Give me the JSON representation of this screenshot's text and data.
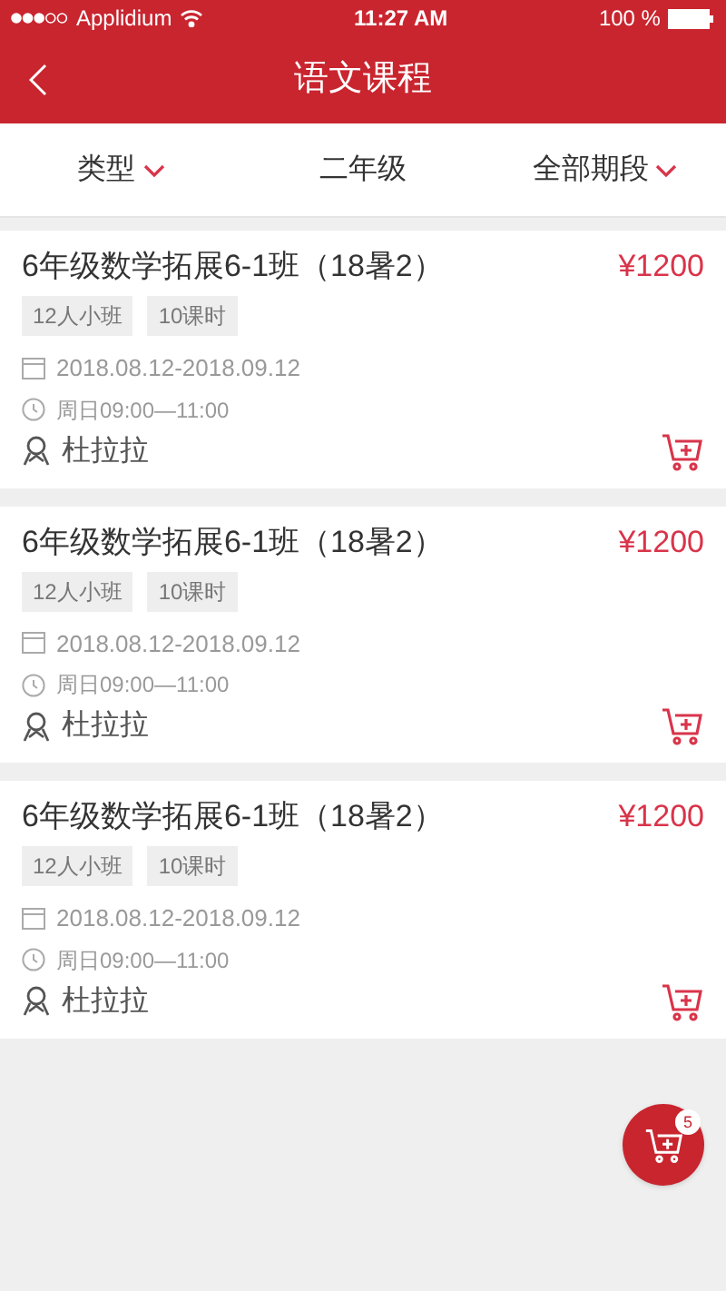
{
  "status_bar": {
    "carrier": "Applidium",
    "time": "11:27 AM",
    "battery": "100 %"
  },
  "nav": {
    "title": "语文课程"
  },
  "filters": [
    {
      "label": "类型",
      "dropdown": true
    },
    {
      "label": "二年级",
      "dropdown": false
    },
    {
      "label": "全部期段",
      "dropdown": true
    }
  ],
  "courses": [
    {
      "title": "6年级数学拓展6-1班（18暑2）",
      "price": "¥1200",
      "tags": [
        "12人小班",
        "10课时"
      ],
      "dates": "2018.08.12-2018.09.12",
      "time": "周日09:00—11:00",
      "teacher": "杜拉拉"
    },
    {
      "title": "6年级数学拓展6-1班（18暑2）",
      "price": "¥1200",
      "tags": [
        "12人小班",
        "10课时"
      ],
      "dates": "2018.08.12-2018.09.12",
      "time": "周日09:00—11:00",
      "teacher": "杜拉拉"
    },
    {
      "title": "6年级数学拓展6-1班（18暑2）",
      "price": "¥1200",
      "tags": [
        "12人小班",
        "10课时"
      ],
      "dates": "2018.08.12-2018.09.12",
      "time": "周日09:00—11:00",
      "teacher": "杜拉拉"
    }
  ],
  "cart": {
    "count": "5"
  }
}
